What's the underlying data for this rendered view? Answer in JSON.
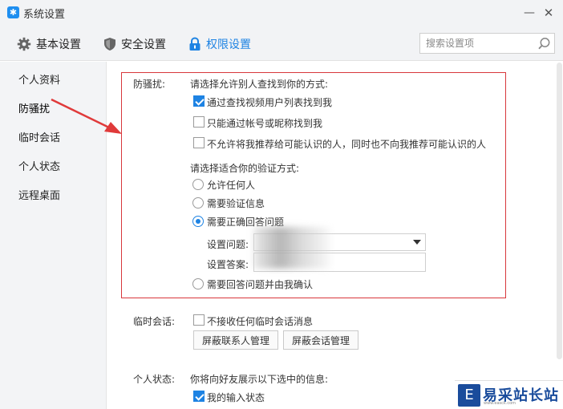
{
  "window": {
    "title": "系统设置",
    "min_label": "—",
    "close_label": "✕",
    "icon_glyph": "✱"
  },
  "toolbar": {
    "tabs": [
      {
        "label": "基本设置",
        "icon": "gear-icon"
      },
      {
        "label": "安全设置",
        "icon": "shield-icon"
      },
      {
        "label": "权限设置",
        "icon": "lock-icon",
        "active": true
      }
    ],
    "search_placeholder": "搜索设置项"
  },
  "sidebar": {
    "items": [
      {
        "label": "个人资料"
      },
      {
        "label": "防骚扰",
        "active": true
      },
      {
        "label": "临时会话"
      },
      {
        "label": "个人状态"
      },
      {
        "label": "远程桌面"
      }
    ]
  },
  "anti_harass": {
    "label": "防骚扰:",
    "find_title": "请选择允许别人查找到你的方式:",
    "find_options": [
      {
        "label": "通过查找视频用户列表找到我",
        "checked": true
      },
      {
        "label": "只能通过帐号或昵称找到我",
        "checked": false
      },
      {
        "label": "不允许将我推荐给可能认识的人，同时也不向我推荐可能认识的人",
        "checked": false
      }
    ],
    "verify_title": "请选择适合你的验证方式:",
    "verify_options": [
      {
        "label": "允许任何人",
        "selected": false
      },
      {
        "label": "需要验证信息",
        "selected": false
      },
      {
        "label": "需要正确回答问题",
        "selected": true
      }
    ],
    "question_label": "设置问题:",
    "answer_label": "设置答案:",
    "last_option": {
      "label": "需要回答问题并由我确认",
      "selected": false
    }
  },
  "temp_session": {
    "label": "临时会话:",
    "option": {
      "label": "不接收任何临时会话消息",
      "checked": false
    },
    "buttons": [
      "屏蔽联系人管理",
      "屏蔽会话管理"
    ]
  },
  "personal_status": {
    "label": "个人状态:",
    "desc": "你将向好友展示以下选中的信息:",
    "option": {
      "label": "我的输入状态",
      "checked": true
    }
  },
  "watermark": {
    "logo_glyph": "E",
    "text": "易采站长站",
    "url": "www.easck.com"
  },
  "colors": {
    "accent": "#1e83e3",
    "highlight_box": "#d8373b",
    "sidebar_bg": "#f3f4f6",
    "arrow": "#e03a3a"
  }
}
